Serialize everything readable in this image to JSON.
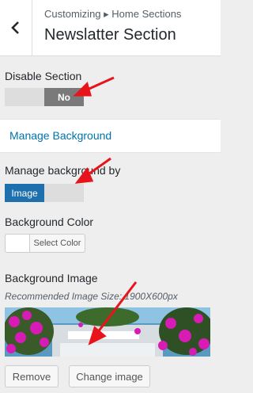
{
  "header": {
    "breadcrumb": "Customizing ▸ Home Sections",
    "title": "Newslatter Section",
    "back_icon": "chevron-left-icon"
  },
  "disable_section": {
    "label": "Disable Section",
    "toggle_value": "No"
  },
  "manage_background_link": "Manage Background",
  "manage_by": {
    "label": "Manage background by",
    "toggle_value": "Image",
    "accent": "#1e6fae"
  },
  "background_color": {
    "label": "Background Color",
    "button": "Select Color"
  },
  "background_image": {
    "label": "Background Image",
    "hint": "Recommended Image Size: 1900X600px",
    "remove_button": "Remove",
    "change_button": "Change image"
  },
  "colors": {
    "link": "#0073aa",
    "arrow": "#e8141b"
  }
}
